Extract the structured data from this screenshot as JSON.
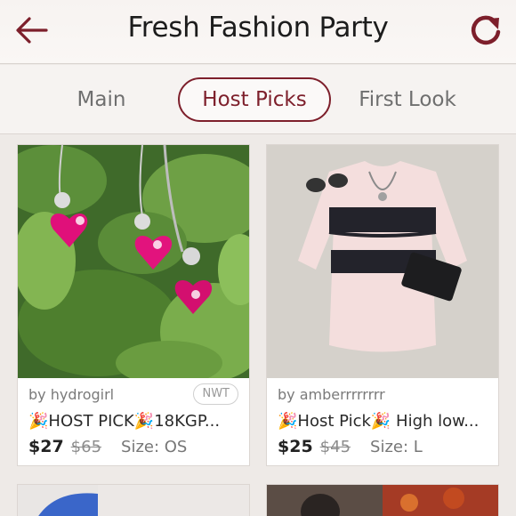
{
  "header": {
    "title": "Fresh Fashion Party",
    "back_icon": "back-arrow-icon",
    "refresh_icon": "refresh-icon",
    "accent_color": "#7d1f2b"
  },
  "tabs": [
    {
      "label": "Main",
      "active": false
    },
    {
      "label": "Host Picks",
      "active": true
    },
    {
      "label": "First Look",
      "active": false
    }
  ],
  "listings": [
    {
      "seller": "by hydrogirl",
      "badge": "NWT",
      "title": "🎉HOST PICK🎉18KGP...",
      "price": "$27",
      "original_price": "$65",
      "size": "Size: OS"
    },
    {
      "seller": "by amberrrrrrrr",
      "badge": "",
      "title": "🎉Host Pick🎉 High low...",
      "price": "$25",
      "original_price": "$45",
      "size": "Size: L"
    }
  ]
}
